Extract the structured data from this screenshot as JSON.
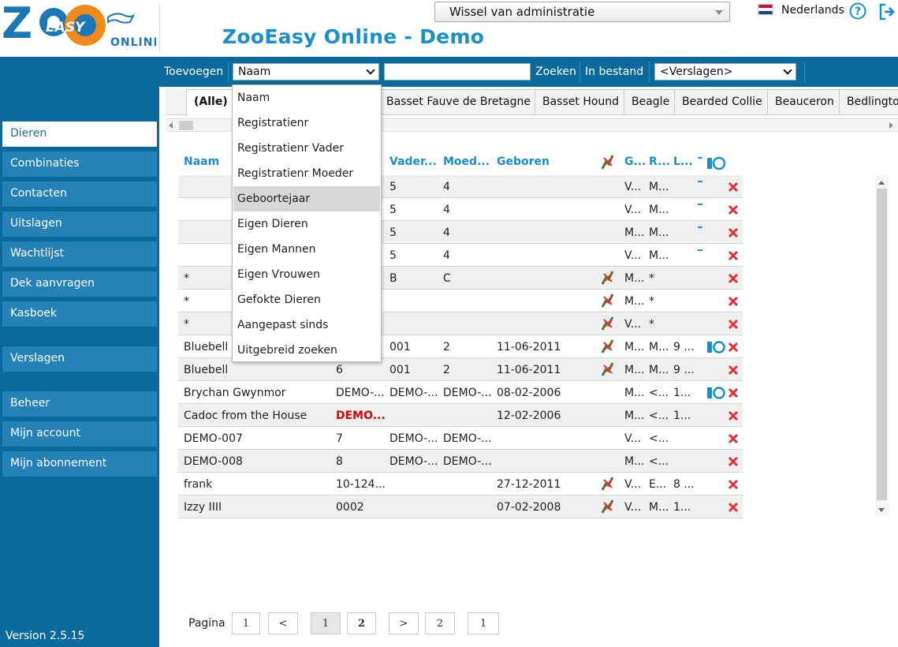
{
  "header": {
    "logo_text_top": "EASY",
    "logo_text_bottom": "ONLINE",
    "title": "ZooEasy Online - Demo",
    "admin_select": "Wissel van administratie",
    "language": "Nederlands"
  },
  "toolbar": {
    "add_label": "Toevoegen",
    "field_select": "Naam",
    "search_value": "",
    "search_label": "Zoeken",
    "in_file_label": "In bestand",
    "report_select": "<Verslagen>"
  },
  "breed_tabs": [
    "(Alle)",
    "Basset Fauve de Bretagne",
    "Basset Hound",
    "Beagle",
    "Bearded Collie",
    "Beauceron",
    "Bedlington"
  ],
  "sidebar": {
    "items": [
      "Dieren",
      "Combinaties",
      "Contacten",
      "Uitslagen",
      "Wachtlijst",
      "Dek aanvragen",
      "Kasboek",
      "Verslagen",
      "Beheer",
      "Mijn account",
      "Mijn abonnement"
    ],
    "version": "Version 2.5.15"
  },
  "table": {
    "headers": {
      "naam": "Naam",
      "vader": "Vader...",
      "moeder": "Moed...",
      "geboren": "Geboren",
      "g": "G...",
      "r": "R...",
      "l": "L..."
    },
    "rows": [
      {
        "naam": "",
        "reg": "",
        "vader": "5",
        "moeder": "4",
        "geboren": "",
        "icon": false,
        "g": "V...",
        "r": "M...",
        "l": "",
        "dash": true,
        "cam": false,
        "redreg": false
      },
      {
        "naam": "",
        "reg": "",
        "vader": "5",
        "moeder": "4",
        "geboren": "",
        "icon": false,
        "g": "V...",
        "r": "M...",
        "l": "",
        "dash": true,
        "cam": false,
        "redreg": false
      },
      {
        "naam": "",
        "reg": "",
        "vader": "5",
        "moeder": "4",
        "geboren": "",
        "icon": false,
        "g": "M...",
        "r": "M...",
        "l": "",
        "dash": true,
        "cam": false,
        "redreg": false
      },
      {
        "naam": "",
        "reg": "",
        "vader": "5",
        "moeder": "4",
        "geboren": "",
        "icon": false,
        "g": "V...",
        "r": "M...",
        "l": "",
        "dash": true,
        "cam": false,
        "redreg": false
      },
      {
        "naam": "*",
        "reg": "",
        "vader": "B",
        "moeder": "C",
        "geboren": "",
        "icon": true,
        "g": "M...",
        "r": "*",
        "l": "",
        "dash": false,
        "cam": false,
        "redreg": false
      },
      {
        "naam": "*",
        "reg": "",
        "vader": "",
        "moeder": "",
        "geboren": "",
        "icon": true,
        "g": "M...",
        "r": "*",
        "l": "",
        "dash": false,
        "cam": false,
        "redreg": false
      },
      {
        "naam": "*",
        "reg": "",
        "vader": "",
        "moeder": "",
        "geboren": "",
        "icon": true,
        "g": "V...",
        "r": "*",
        "l": "",
        "dash": false,
        "cam": false,
        "redreg": false
      },
      {
        "naam": "Bluebell",
        "reg": "",
        "vader": "001",
        "moeder": "2",
        "geboren": "11-06-2011",
        "icon": true,
        "g": "M...",
        "r": "M...",
        "l": "9 ...",
        "dash": false,
        "cam": true,
        "redreg": false
      },
      {
        "naam": "Bluebell",
        "reg": "6",
        "vader": "001",
        "moeder": "2",
        "geboren": "11-06-2011",
        "icon": true,
        "g": "M...",
        "r": "M...",
        "l": "9 ...",
        "dash": false,
        "cam": false,
        "redreg": false
      },
      {
        "naam": "Brychan Gwynmor",
        "reg": "DEMO-...",
        "vader": "DEMO-...",
        "moeder": "DEMO-...",
        "geboren": "08-02-2006",
        "icon": false,
        "g": "M...",
        "r": "<...",
        "l": "1...",
        "dash": false,
        "cam": true,
        "redreg": false
      },
      {
        "naam": "Cadoc from the House",
        "reg": "DEMO...",
        "vader": "",
        "moeder": "",
        "geboren": "12-02-2006",
        "icon": false,
        "g": "M...",
        "r": "<...",
        "l": "1...",
        "dash": false,
        "cam": false,
        "redreg": true
      },
      {
        "naam": "DEMO-007",
        "reg": "7",
        "vader": "DEMO-...",
        "moeder": "DEMO-...",
        "geboren": "",
        "icon": false,
        "g": "V...",
        "r": "<...",
        "l": "",
        "dash": false,
        "cam": false,
        "redreg": false
      },
      {
        "naam": "DEMO-008",
        "reg": "8",
        "vader": "DEMO-...",
        "moeder": "DEMO-...",
        "geboren": "",
        "icon": false,
        "g": "M...",
        "r": "<...",
        "l": "",
        "dash": false,
        "cam": false,
        "redreg": false
      },
      {
        "naam": "frank",
        "reg": "10-124...",
        "vader": "",
        "moeder": "",
        "geboren": "27-12-2011",
        "icon": true,
        "g": "V...",
        "r": "E...",
        "l": "8 ...",
        "dash": false,
        "cam": false,
        "redreg": false
      },
      {
        "naam": "Izzy IIII",
        "reg": "0002",
        "vader": "",
        "moeder": "",
        "geboren": "07-02-2008",
        "icon": true,
        "g": "V...",
        "r": "M...",
        "l": "1...",
        "dash": false,
        "cam": false,
        "redreg": false
      }
    ]
  },
  "dropdown": {
    "items": [
      "Naam",
      "Registratienr",
      "Registratienr Vader",
      "Registratienr Moeder",
      "Geboortejaar",
      "Eigen Dieren",
      "Eigen Mannen",
      "Eigen Vrouwen",
      "Gefokte Dieren",
      "Aangepast sinds",
      "Uitgebreid zoeken"
    ],
    "highlighted": 4
  },
  "pagination": {
    "label": "Pagina",
    "buttons": [
      "1",
      "<",
      "1",
      "2",
      ">",
      "2",
      "1"
    ]
  }
}
